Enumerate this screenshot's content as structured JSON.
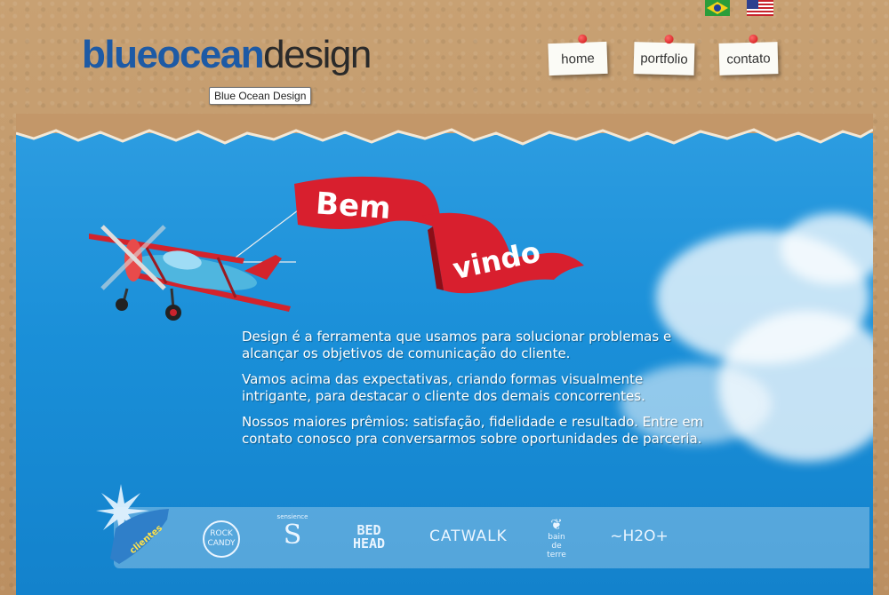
{
  "site": {
    "logo": {
      "part1": "blueocean",
      "part2": "design"
    },
    "logo_tooltip": "Blue Ocean Design"
  },
  "languages": [
    {
      "name": "brazil-flag"
    },
    {
      "name": "usa-flag"
    }
  ],
  "nav": [
    {
      "label": "home"
    },
    {
      "label": "portfolio"
    },
    {
      "label": "contato"
    }
  ],
  "banner": {
    "line1": "Bem",
    "line2": "vindo"
  },
  "intro": [
    "Design é a ferramenta que usamos para solucionar problemas e alcançar os objetivos de comunicação do cliente.",
    "Vamos acima das expectativas, criando formas visualmente intrigante, para destacar o cliente dos demais concorrentes.",
    "Nossos maiores prêmios: satisfação, fidelidade e resultado. Entre em contato conosco pra conversarmos sobre oportunidades de parceria."
  ],
  "clients": {
    "tag": "clientes",
    "logos": [
      {
        "name": "ROCK CANDY",
        "line1": "ROCK",
        "line2": "CANDY"
      },
      {
        "name": "sensience",
        "line1": "sensience",
        "line2": "S"
      },
      {
        "name": "BED HEAD",
        "line1": "BED",
        "line2": "HEAD"
      },
      {
        "name": "CATWALK",
        "line1": "CATWALK"
      },
      {
        "name": "bain de terre",
        "line1": "bain",
        "line2": "de",
        "line3": "terre"
      },
      {
        "name": "H2O+",
        "line1": "~H2O+"
      }
    ]
  },
  "colors": {
    "logo_blue": "#1d5aa5",
    "sky": "#1a8fd8",
    "banner_red": "#d81f2e",
    "cork": "#bb8f61"
  }
}
